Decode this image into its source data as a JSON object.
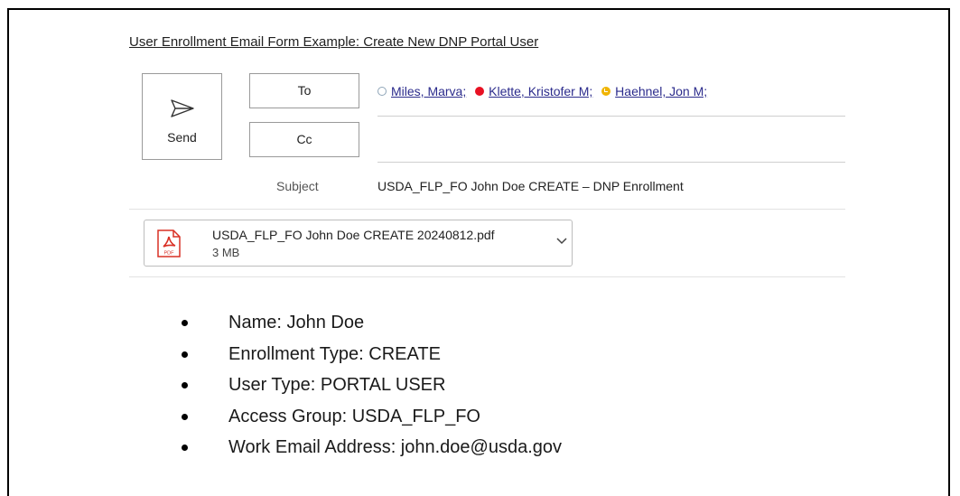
{
  "heading": "User Enrollment Email Form Example: Create New DNP Portal User",
  "compose": {
    "send_label": "Send",
    "to_label": "To",
    "cc_label": "Cc",
    "recipients": [
      {
        "name": "Miles, Marva;",
        "status": "available"
      },
      {
        "name": "Klette, Kristofer M;",
        "status": "busy"
      },
      {
        "name": "Haehnel, Jon M;",
        "status": "away"
      }
    ],
    "cc_value": "",
    "subject_label": "Subject",
    "subject_value": "USDA_FLP_FO John Doe CREATE – DNP Enrollment"
  },
  "attachment": {
    "icon": "pdf-icon",
    "filename": "USDA_FLP_FO John Doe CREATE 20240812.pdf",
    "size": "3 MB",
    "icon_label": "PDF"
  },
  "body_items": [
    "Name: John Doe",
    "Enrollment Type: CREATE",
    "User Type: PORTAL USER",
    "Access Group: USDA_FLP_FO",
    "Work Email Address: john.doe@usda.gov"
  ],
  "colors": {
    "available": "#8fa5b8",
    "busy": "#e81123",
    "away": "#f0b400",
    "pdf_red": "#d93025"
  }
}
